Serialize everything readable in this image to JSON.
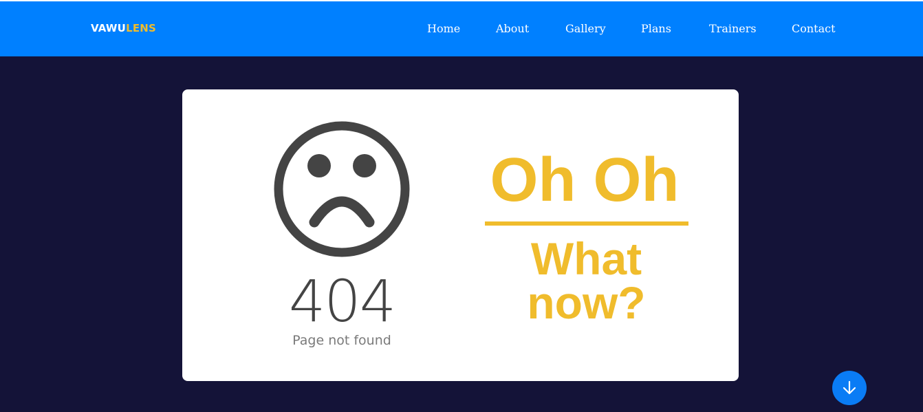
{
  "brand": {
    "part1": "VAWU",
    "part2": "LENS"
  },
  "nav": {
    "items": [
      {
        "label": "Home"
      },
      {
        "label": "About"
      },
      {
        "label": "Gallery"
      },
      {
        "label": "Plans"
      },
      {
        "label": "Trainers"
      },
      {
        "label": "Contact"
      }
    ]
  },
  "error": {
    "icon": "sad-face-icon",
    "code": "404",
    "message": "Page not found",
    "headline": "Oh Oh",
    "subline": "What now?"
  },
  "scroll_button": {
    "icon": "arrow-down-icon"
  },
  "colors": {
    "nav_background": "#0080ff",
    "page_background": "#141338",
    "accent_yellow": "#f0bc2c",
    "icon_dark": "#444444",
    "scroll_button": "#0a7cf5"
  }
}
